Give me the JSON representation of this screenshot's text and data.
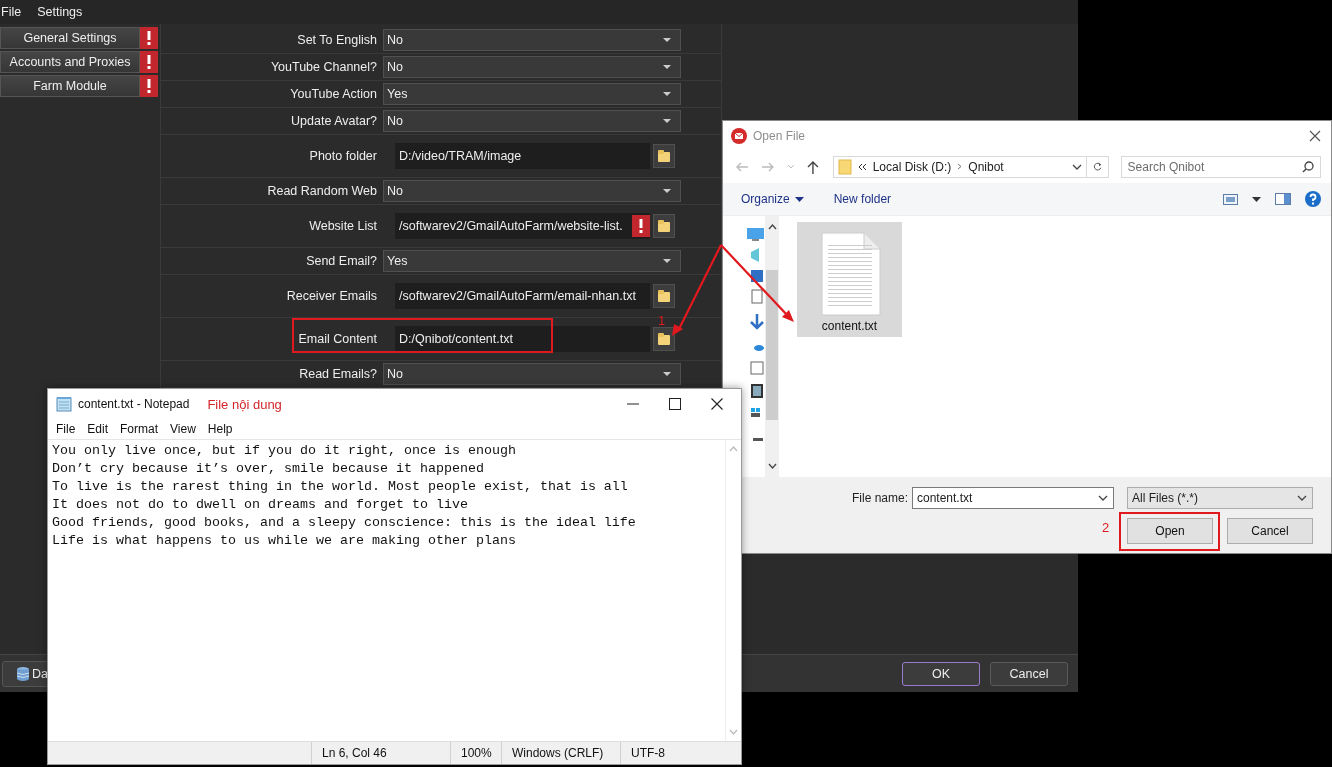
{
  "app": {
    "menu": [
      "File",
      "Settings"
    ],
    "sidebar": [
      {
        "label": "General Settings",
        "warning": true
      },
      {
        "label": "Accounts and Proxies",
        "warning": true
      },
      {
        "label": "Farm Module",
        "warning": true
      }
    ],
    "settings": [
      {
        "kind": "select",
        "label": "Set To English",
        "value": "No",
        "warning": false,
        "highlighted": false
      },
      {
        "kind": "select",
        "label": "YouTube Channel?",
        "value": "No",
        "warning": false,
        "highlighted": false
      },
      {
        "kind": "select",
        "label": "YouTube Action",
        "value": "Yes",
        "warning": false,
        "highlighted": false
      },
      {
        "kind": "select",
        "label": "Update Avatar?",
        "value": "No",
        "warning": false,
        "highlighted": false
      },
      {
        "kind": "path",
        "label": "Photo folder",
        "value": "D:/video/TRAM/image",
        "warning": false,
        "highlighted": false
      },
      {
        "kind": "select",
        "label": "Read Random Web",
        "value": "No",
        "warning": false,
        "highlighted": false
      },
      {
        "kind": "path",
        "label": "Website List",
        "value": "/softwarev2/GmailAutoFarm/website-list.",
        "warning": true,
        "highlighted": false
      },
      {
        "kind": "select",
        "label": "Send Email?",
        "value": "Yes",
        "warning": false,
        "highlighted": false
      },
      {
        "kind": "path",
        "label": "Receiver Emails",
        "value": "/softwarev2/GmailAutoFarm/email-nhan.txt",
        "warning": false,
        "highlighted": false
      },
      {
        "kind": "path",
        "label": "Email Content",
        "value": "D:/Qnibot/content.txt",
        "warning": false,
        "highlighted": true,
        "step": "1"
      },
      {
        "kind": "select",
        "label": "Read Emails?",
        "value": "No",
        "warning": false,
        "highlighted": false
      }
    ],
    "footer": {
      "left_button": "Da",
      "buttons": [
        {
          "label": "OK",
          "default": true
        },
        {
          "label": "Cancel",
          "default": false
        }
      ]
    }
  },
  "open_file_dialog": {
    "title": "Open File",
    "path": [
      "Local Disk (D:)",
      "Qnibot"
    ],
    "search": {
      "placeholder": "Search Qnibot"
    },
    "toolbar": [
      "Organize",
      "New folder"
    ],
    "files": [
      {
        "name": "content.txt",
        "selected": true
      }
    ],
    "file_name_label": "File name:",
    "file_name": "content.txt",
    "file_type": "All Files (*.*)",
    "buttons": [
      {
        "label": "Open",
        "marked": true
      },
      {
        "label": "Cancel",
        "marked": false
      }
    ],
    "step": "2"
  },
  "notepad": {
    "title": "content.txt - Notepad",
    "note": "File nội dung",
    "menu": [
      "File",
      "Edit",
      "Format",
      "View",
      "Help"
    ],
    "lines": [
      "You only live once, but if you do it right, once is enough",
      "Don’t cry because it’s over, smile because it happened",
      "To live is the rarest thing in the world. Most people exist, that is all",
      "It does not do to dwell on dreams and forget to live",
      "Good friends, good books, and a sleepy conscience: this is the ideal life",
      "Life is what happens to us while we are making other plans"
    ],
    "status": [
      "Ln 6, Col 46",
      "100%",
      "Windows (CRLF)",
      "UTF-8"
    ]
  }
}
